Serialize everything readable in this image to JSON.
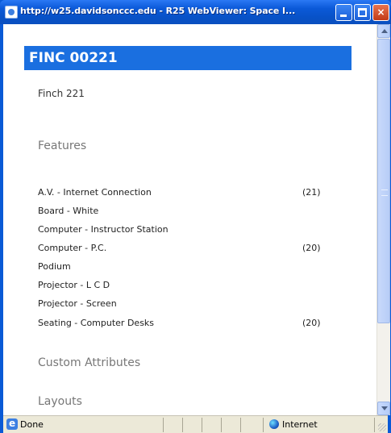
{
  "window": {
    "title": "http://w25.davidsonccc.edu - R25 WebViewer: Space I...",
    "buttons": {
      "minimize": "minimize",
      "maximize": "maximize",
      "close": "×"
    }
  },
  "space": {
    "code": "FINC 00221",
    "name": "Finch 221"
  },
  "sections": {
    "features": "Features",
    "custom_attributes": "Custom Attributes",
    "layouts": "Layouts"
  },
  "features": [
    {
      "name": "A.V. - Internet Connection",
      "qty": "(21)"
    },
    {
      "name": "Board - White",
      "qty": ""
    },
    {
      "name": "Computer - Instructor Station",
      "qty": ""
    },
    {
      "name": "Computer - P.C.",
      "qty": "(20)"
    },
    {
      "name": "Podium",
      "qty": ""
    },
    {
      "name": "Projector - L C D",
      "qty": ""
    },
    {
      "name": "Projector - Screen",
      "qty": ""
    },
    {
      "name": "Seating - Computer Desks",
      "qty": "(20)"
    }
  ],
  "statusbar": {
    "status": "Done",
    "zone": "Internet"
  },
  "icons": [
    "ie-page-icon",
    "minimize-icon",
    "maximize-icon",
    "close-icon",
    "scroll-up-icon",
    "scroll-down-icon",
    "internet-zone-icon"
  ],
  "colors": {
    "titlebar": "#0b59d8",
    "header": "#1a6fe0",
    "close": "#c23a17"
  }
}
